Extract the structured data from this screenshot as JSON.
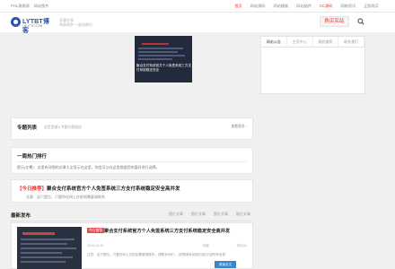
{
  "topbar": {
    "left_links": [
      "PHL源客源",
      "网站图片"
    ],
    "right_links": [
      "首页",
      "网站源码",
      "网站模板",
      "网站插件",
      "CC源码",
      "网络资讯",
      "正版购买"
    ],
    "active_index": 0
  },
  "header": {
    "logo_text": "LYTBT博客",
    "logo_sub": "LBLYTBT.COM",
    "slogan_line1": "开源分享",
    "slogan_line2": "共同进步 一起向前行",
    "buy_button": "购买实站"
  },
  "hero": {
    "caption": "聚合支付系统官方个人免签系统三方支付系统稳定安全"
  },
  "side_panel": {
    "tabs": [
      "网站公告",
      "主页中心",
      "随机推荐",
      "联系我们"
    ],
    "active_tab": 0
  },
  "topic_section": {
    "title": "专题列表",
    "desc": "这里是输入专题列表描述",
    "more": "查看更多 ›"
  },
  "hot_section": {
    "title": "一周热门排行",
    "tip": "提示(左覆)：这里有详细的文章大全显示在这里，你会可以在这里根据您的喜好进行选择。"
  },
  "notice": {
    "tag": "【今日推荐】",
    "title": "聚合支付系统官方个人免签系统三方支付系统稳定安全高并发",
    "tip": "注意：这只是位，只要你在网上在前如需要请联系"
  },
  "latest": {
    "title": "最新发布",
    "filters": [
      "图片文章",
      "图片文章",
      "图片文章",
      "图片文章"
    ]
  },
  "post": {
    "badge": "今日推荐",
    "title": "聚合支付系统官方个人免签系统三方支付系统稳定安全高并发",
    "date": "2016-12-19",
    "views": "热度",
    "comments": "评论(0)",
    "excerpt": "注意：这只是位，只要在网上在前如需要请联系，请联系你们。 [详情请参阅其内容]介绍所有信息",
    "read_more": "阅读全文"
  },
  "colors": {
    "accent": "#e33333",
    "brand": "#2b56a8",
    "button_blue": "#3a86c8"
  }
}
